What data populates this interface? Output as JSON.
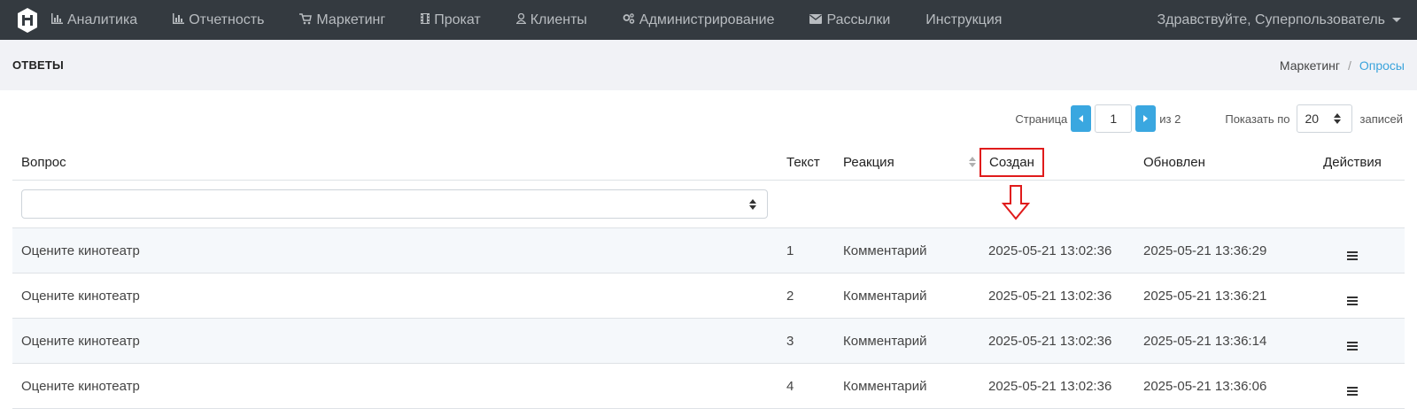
{
  "navbar": {
    "items": [
      {
        "label": "Аналитика",
        "icon": "bar-chart-icon"
      },
      {
        "label": "Отчетность",
        "icon": "bar-chart-icon"
      },
      {
        "label": "Маркетинг",
        "icon": "cart-icon"
      },
      {
        "label": "Прокат",
        "icon": "film-icon"
      },
      {
        "label": "Клиенты",
        "icon": "user-icon"
      },
      {
        "label": "Администрирование",
        "icon": "cogs-icon"
      },
      {
        "label": "Рассылки",
        "icon": "envelope-icon"
      },
      {
        "label": "Инструкция",
        "icon": ""
      }
    ],
    "user_greeting": "Здравствуйте, Суперпользователь"
  },
  "header": {
    "title": "ОТВЕТЫ",
    "breadcrumb": {
      "parent": "Маркетинг",
      "separator": "/",
      "current": "Опросы"
    }
  },
  "pagination": {
    "page_label": "Страница",
    "current_page": "1",
    "of_total": "из 2",
    "show_label": "Показать по",
    "page_size": "20",
    "records_label": "записей"
  },
  "table": {
    "columns": {
      "question": "Вопрос",
      "text": "Текст",
      "reaction": "Реакция",
      "created": "Создан",
      "updated": "Обновлен",
      "actions": "Действия"
    },
    "rows": [
      {
        "question": "Оцените кинотеатр",
        "text": "1",
        "reaction": "Комментарий",
        "created": "2025-05-21 13:02:36",
        "updated": "2025-05-21 13:36:29"
      },
      {
        "question": "Оцените кинотеатр",
        "text": "2",
        "reaction": "Комментарий",
        "created": "2025-05-21 13:02:36",
        "updated": "2025-05-21 13:36:21"
      },
      {
        "question": "Оцените кинотеатр",
        "text": "3",
        "reaction": "Комментарий",
        "created": "2025-05-21 13:02:36",
        "updated": "2025-05-21 13:36:14"
      },
      {
        "question": "Оцените кинотеатр",
        "text": "4",
        "reaction": "Комментарий",
        "created": "2025-05-21 13:02:36",
        "updated": "2025-05-21 13:36:06"
      }
    ]
  },
  "colors": {
    "navbar_bg": "#343a40",
    "header_bg": "#f1f2f6",
    "accent": "#3aa7e0",
    "annotation": "#e01b1b"
  }
}
